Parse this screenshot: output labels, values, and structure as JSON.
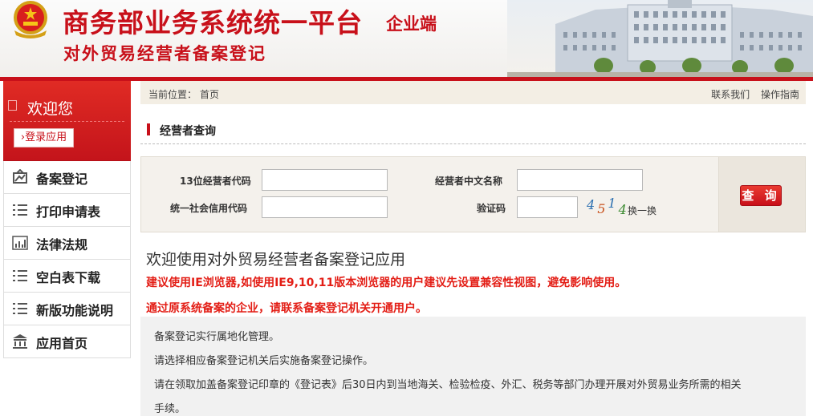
{
  "header": {
    "title_main": "商务部业务系统统一平台",
    "title_tag": "企业端",
    "title_sub": "对外贸易经营者备案登记"
  },
  "sidebar": {
    "welcome": "欢迎您",
    "login_button": "›登录应用",
    "items": [
      {
        "label": "备案登记",
        "icon": "register-icon"
      },
      {
        "label": "打印申请表",
        "icon": "list-icon"
      },
      {
        "label": "法律法规",
        "icon": "chart-icon"
      },
      {
        "label": "空白表下载",
        "icon": "list-icon"
      },
      {
        "label": "新版功能说明",
        "icon": "list-icon"
      },
      {
        "label": "应用首页",
        "icon": "home-icon"
      }
    ]
  },
  "breadcrumb": {
    "label": "当前位置：",
    "current": "首页"
  },
  "top_links": {
    "contact": "联系我们",
    "guide": "操作指南"
  },
  "section_title": "经营者查询",
  "query_form": {
    "code13_label": "13位经营者代码",
    "code13_value": "",
    "name_label": "经营者中文名称",
    "name_value": "",
    "credit_label": "统一社会信用代码",
    "credit_value": "",
    "captcha_label": "验证码",
    "captcha_value": "",
    "captcha_digits": [
      "4",
      "5",
      "1",
      "4"
    ],
    "captcha_refresh": "换一换",
    "submit": "查 询"
  },
  "intro": {
    "title": "欢迎使用对外贸易经营者备案登记应用",
    "notice1": "建议使用IE浏览器,如使用IE9,10,11版本浏览器的用户建议先设置兼容性视图，避免影响使用。",
    "notice2": "通过原系统备案的企业，请联系备案登记机关开通用户。",
    "rules": [
      "备案登记实行属地化管理。",
      "请选择相应备案登记机关后实施备案登记操作。",
      "请在领取加盖备案登记印章的《登记表》后30日内到当地海关、检验检疫、外汇、税务等部门办理开展对外贸易业务所需的相关",
      "手续。"
    ]
  },
  "colors": {
    "brand_red": "#c8101a",
    "notice_red": "#e31e16",
    "breadcrumb_bg": "#f3eee4"
  }
}
